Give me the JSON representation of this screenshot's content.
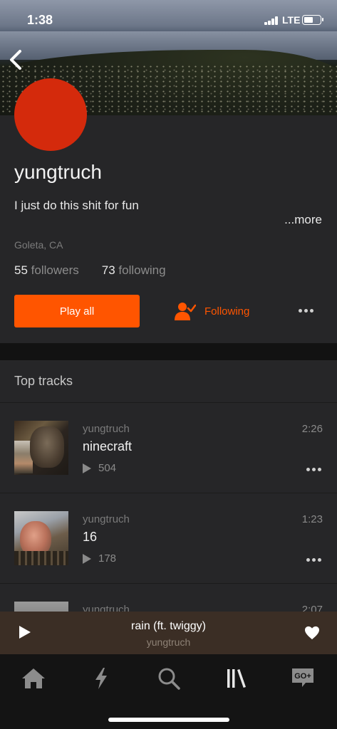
{
  "status_bar": {
    "time": "1:38",
    "network": "LTE",
    "battery_level": 0.55
  },
  "profile": {
    "username": "yungtruch",
    "bio": "I just do this shit for fun",
    "more_label": "...more",
    "location": "Goleta, CA",
    "followers_count": "55",
    "followers_label": "followers",
    "following_count": "73",
    "following_label": "following",
    "play_all_label": "Play all",
    "following_button_label": "Following",
    "avatar_color": "#d42a0c"
  },
  "top_tracks": {
    "header": "Top tracks",
    "items": [
      {
        "artist": "yungtruch",
        "title": "ninecraft",
        "plays": "504",
        "duration": "2:26"
      },
      {
        "artist": "yungtruch",
        "title": "16",
        "plays": "178",
        "duration": "1:23"
      },
      {
        "artist": "yungtruch",
        "title": "",
        "plays": "",
        "duration": "2:07"
      }
    ]
  },
  "mini_player": {
    "title": "rain (ft. twiggy)",
    "artist": "yungtruch"
  },
  "tab_bar": {
    "tabs": [
      {
        "icon": "home-icon"
      },
      {
        "icon": "stream-bolt-icon"
      },
      {
        "icon": "search-icon"
      },
      {
        "icon": "library-icon"
      },
      {
        "icon": "go-plus-icon",
        "label": "GO+"
      }
    ]
  },
  "colors": {
    "accent": "#ff5500",
    "background": "#262628",
    "mini_player": "#3b2e25"
  }
}
